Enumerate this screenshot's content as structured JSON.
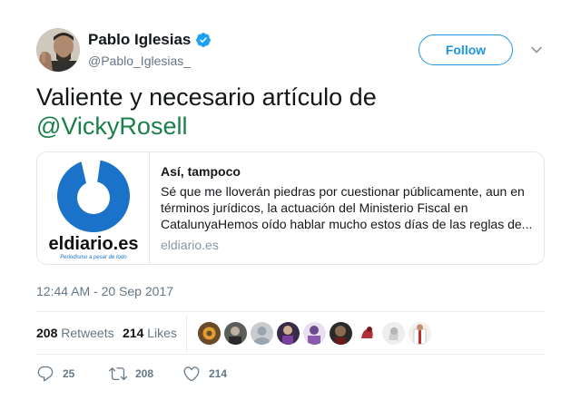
{
  "author": {
    "name": "Pablo Iglesias",
    "handle": "@Pablo_Iglesias_",
    "verified": true
  },
  "follow_label": "Follow",
  "tweet": {
    "text": "Valiente y necesario artículo de",
    "mention": "@VickyRosell"
  },
  "card": {
    "logo_text": "eldiario.es",
    "logo_tagline": "Periodismo a pesar de todo",
    "title": "Así, tampoco",
    "description": "Sé que me lloverán piedras por cuestionar públicamente, aun en términos jurídicos, la actuación del Ministerio Fiscal en CatalunyaHemos oído hablar mucho estos días de las reglas de...",
    "domain": "eldiario.es"
  },
  "timestamp": "12:44 AM - 20 Sep 2017",
  "stats": {
    "retweets_count": "208",
    "retweets_label": "Retweets",
    "likes_count": "214",
    "likes_label": "Likes"
  },
  "actions": {
    "reply_count": "25",
    "retweet_count": "208",
    "like_count": "214"
  },
  "colors": {
    "link_blue": "#1b95e0",
    "mention_green": "#1b7f4a",
    "muted_gray": "#657786",
    "logo_blue": "#1a73c8"
  },
  "icons": [
    "verified-badge-icon",
    "chevron-down-icon",
    "reply-icon",
    "retweet-icon",
    "heart-icon"
  ]
}
